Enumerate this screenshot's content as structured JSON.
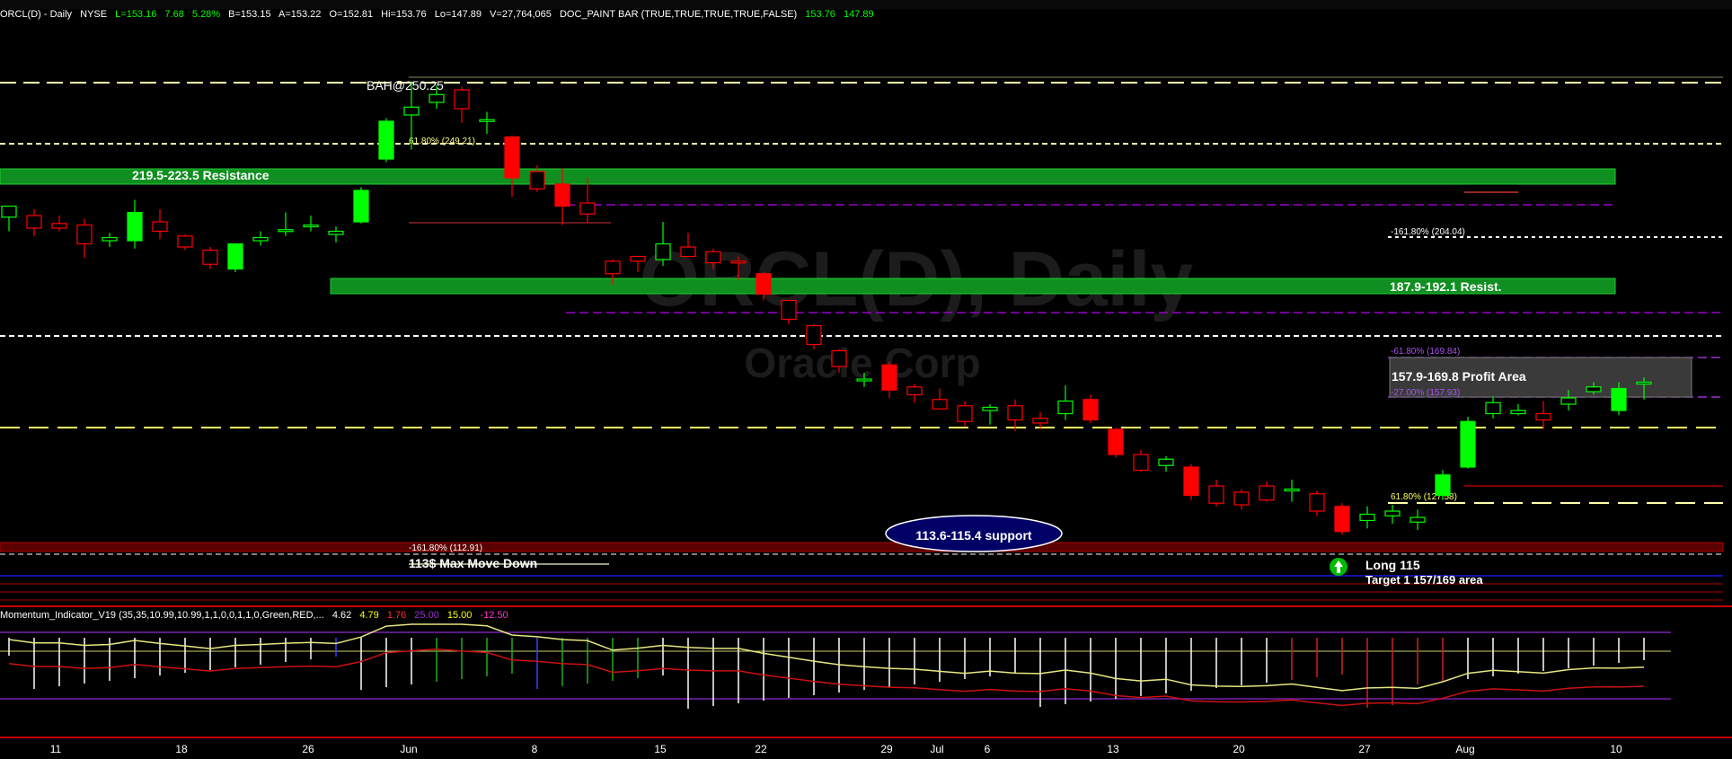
{
  "header": {
    "symbol": "ORCL(D) - Daily",
    "exchange": "NYSE",
    "last": "L=153.16",
    "change": "7.68",
    "change_pct": "5.28%",
    "bid": "B=153.15",
    "ask": "A=153.22",
    "open": "O=152.81",
    "high": "Hi=153.76",
    "low": "Lo=147.89",
    "volume": "V=27,764,065",
    "study": "DOC_PAINT BAR (TRUE,TRUE,TRUE,TRUE,FALSE)",
    "study_v1": "153.76",
    "study_v2": "147.89"
  },
  "watermark": {
    "line1": "ORCL(D), Daily",
    "line2": "Oracle Corp"
  },
  "annotations": {
    "resistance_upper": "219.5-223.5 Resistance",
    "resistance_lower": "187.9-192.1 Resist.",
    "profit_area": "157.9-169.8 Profit Area",
    "support_oval": "113.6-115.4 support",
    "max_move": "113$ Max Move Down",
    "long_entry": "Long 115",
    "target": "Target 1 157/169 area",
    "top_label": "BAH@250.25",
    "fib_top": "61.80% (249.21)",
    "fib_ext_up": "-161.80% (204.04)",
    "fib_profit_hi": "-61.80% (169.84)",
    "fib_profit_lo": "-27.00% (157.93)",
    "fib_61": "61.80% (127.58)",
    "fib_ext_down": "-161.80% (112.91)"
  },
  "oscillator": {
    "name": "Momentum_Indicator_V19 (35,35,10.99,10.99,1,1,0,0,1,1,0,Green,RED,...",
    "v1": "4.62",
    "v2": "4.79",
    "v3": "1.76",
    "v4": "25.00",
    "v5": "15.00",
    "v6": "-12.50"
  },
  "x_axis_labels": [
    "11",
    "18",
    "26",
    "Jun",
    "8",
    "15",
    "22",
    "29",
    "Jul",
    "6",
    "13",
    "20",
    "27",
    "Aug",
    "10"
  ],
  "colors": {
    "up": "#00ff00",
    "down": "#ff0000",
    "resistance_band": "#0f8f1f",
    "support_band": "#7a0000",
    "fib": "#ffff66",
    "purple": "#9900cc",
    "background": "#000000"
  },
  "chart_data": {
    "type": "candlestick",
    "symbol": "ORCL",
    "timeframe": "Daily",
    "ylim": [
      88,
      268
    ],
    "candles": [
      {
        "o": 207.5,
        "h": 209.5,
        "l": 203.0,
        "c": 211.0
      },
      {
        "o": 208.0,
        "h": 210.0,
        "l": 201.5,
        "c": 204.0
      },
      {
        "o": 205.5,
        "h": 208.0,
        "l": 203.0,
        "c": 204.0
      },
      {
        "o": 205.0,
        "h": 207.0,
        "l": 194.5,
        "c": 199.0
      },
      {
        "o": 200.0,
        "h": 202.5,
        "l": 198.0,
        "c": 201.0
      },
      {
        "o": 200.0,
        "h": 213.0,
        "l": 197.5,
        "c": 209.0
      },
      {
        "o": 206.0,
        "h": 210.0,
        "l": 200.5,
        "c": 203.0
      },
      {
        "o": 201.5,
        "h": 202.0,
        "l": 197.0,
        "c": 198.0
      },
      {
        "o": 197.0,
        "h": 198.0,
        "l": 191.0,
        "c": 192.5
      },
      {
        "o": 191.0,
        "h": 199.0,
        "l": 190.0,
        "c": 199.0
      },
      {
        "o": 200.0,
        "h": 203.0,
        "l": 198.5,
        "c": 201.0
      },
      {
        "o": 203.0,
        "h": 209.0,
        "l": 201.5,
        "c": 203.5
      },
      {
        "o": 205.0,
        "h": 208.0,
        "l": 203.0,
        "c": 205.0
      },
      {
        "o": 202.0,
        "h": 204.5,
        "l": 199.5,
        "c": 203.0
      },
      {
        "o": 206.0,
        "h": 217.0,
        "l": 205.5,
        "c": 216.0
      },
      {
        "o": 226.0,
        "h": 239.0,
        "l": 225.0,
        "c": 238.0
      },
      {
        "o": 240.0,
        "h": 250.5,
        "l": 229.0,
        "c": 242.5
      },
      {
        "o": 244.0,
        "h": 249.5,
        "l": 242.0,
        "c": 246.5
      },
      {
        "o": 248.0,
        "h": 249.0,
        "l": 237.5,
        "c": 242.0
      },
      {
        "o": 238.0,
        "h": 241.0,
        "l": 234.0,
        "c": 238.5
      },
      {
        "o": 233.0,
        "h": 233.5,
        "l": 214.0,
        "c": 220.0
      },
      {
        "o": 222.0,
        "h": 224.0,
        "l": 215.5,
        "c": 216.5
      },
      {
        "o": 218.0,
        "h": 223.0,
        "l": 205.0,
        "c": 211.0
      },
      {
        "o": 212.0,
        "h": 220.0,
        "l": 205.5,
        "c": 208.5
      },
      {
        "o": 193.5,
        "h": 194.0,
        "l": 186.0,
        "c": 189.5
      },
      {
        "o": 195.0,
        "h": 195.0,
        "l": 190.0,
        "c": 193.5
      },
      {
        "o": 194.0,
        "h": 206.0,
        "l": 192.0,
        "c": 199.0
      },
      {
        "o": 198.0,
        "h": 202.5,
        "l": 195.5,
        "c": 195.0
      },
      {
        "o": 196.5,
        "h": 197.5,
        "l": 191.0,
        "c": 193.0
      },
      {
        "o": 193.5,
        "h": 195.0,
        "l": 187.5,
        "c": 193.0
      },
      {
        "o": 189.5,
        "h": 190.0,
        "l": 181.0,
        "c": 183.0
      },
      {
        "o": 181.0,
        "h": 181.0,
        "l": 173.5,
        "c": 175.0
      },
      {
        "o": 173.0,
        "h": 173.5,
        "l": 165.5,
        "c": 167.0
      },
      {
        "o": 165.0,
        "h": 165.5,
        "l": 158.0,
        "c": 160.0
      },
      {
        "o": 156.0,
        "h": 158.0,
        "l": 153.5,
        "c": 156.0
      },
      {
        "o": 160.5,
        "h": 161.5,
        "l": 150.0,
        "c": 152.5
      },
      {
        "o": 153.5,
        "h": 154.5,
        "l": 148.5,
        "c": 151.0
      },
      {
        "o": 149.5,
        "h": 153.0,
        "l": 147.0,
        "c": 146.5
      },
      {
        "o": 147.5,
        "h": 149.0,
        "l": 141.0,
        "c": 142.5
      },
      {
        "o": 146.0,
        "h": 148.0,
        "l": 141.5,
        "c": 147.0
      },
      {
        "o": 147.5,
        "h": 149.5,
        "l": 139.5,
        "c": 143.0
      },
      {
        "o": 143.5,
        "h": 145.5,
        "l": 140.0,
        "c": 142.0
      },
      {
        "o": 145.0,
        "h": 154.0,
        "l": 143.0,
        "c": 149.0
      },
      {
        "o": 149.5,
        "h": 151.0,
        "l": 142.0,
        "c": 143.0
      },
      {
        "o": 140.0,
        "h": 140.5,
        "l": 131.0,
        "c": 132.0
      },
      {
        "o": 132.0,
        "h": 133.5,
        "l": 126.5,
        "c": 127.0
      },
      {
        "o": 128.5,
        "h": 131.5,
        "l": 126.5,
        "c": 130.5
      },
      {
        "o": 128.0,
        "h": 129.0,
        "l": 117.5,
        "c": 119.0
      },
      {
        "o": 122.0,
        "h": 124.0,
        "l": 115.5,
        "c": 116.5
      },
      {
        "o": 120.0,
        "h": 121.0,
        "l": 114.5,
        "c": 116.0
      },
      {
        "o": 122.0,
        "h": 123.5,
        "l": 117.0,
        "c": 117.5
      },
      {
        "o": 121.0,
        "h": 124.0,
        "l": 117.0,
        "c": 121.0
      },
      {
        "o": 119.5,
        "h": 120.5,
        "l": 112.5,
        "c": 114.0
      },
      {
        "o": 115.5,
        "h": 116.5,
        "l": 106.5,
        "c": 107.5
      },
      {
        "o": 111.0,
        "h": 115.5,
        "l": 108.5,
        "c": 113.0
      },
      {
        "o": 112.5,
        "h": 116.0,
        "l": 110.0,
        "c": 114.0
      },
      {
        "o": 110.5,
        "h": 114.5,
        "l": 108.0,
        "c": 112.0
      },
      {
        "o": 119.0,
        "h": 127.0,
        "l": 117.5,
        "c": 125.5
      },
      {
        "o": 128.0,
        "h": 144.0,
        "l": 127.5,
        "c": 142.5
      },
      {
        "o": 145.0,
        "h": 150.5,
        "l": 143.5,
        "c": 148.5
      },
      {
        "o": 145.0,
        "h": 148.0,
        "l": 144.5,
        "c": 146.0
      },
      {
        "o": 145.0,
        "h": 149.0,
        "l": 140.0,
        "c": 143.0
      },
      {
        "o": 148.0,
        "h": 152.5,
        "l": 146.0,
        "c": 150.0
      },
      {
        "o": 152.0,
        "h": 155.0,
        "l": 151.0,
        "c": 153.5
      },
      {
        "o": 146.0,
        "h": 155.0,
        "l": 144.5,
        "c": 153.0
      },
      {
        "o": 155.0,
        "h": 156.5,
        "l": 149.5,
        "c": 155.0
      }
    ],
    "resistance_zones": [
      {
        "label": "219.5-223.5 Resistance",
        "low": 219.5,
        "high": 223.5
      },
      {
        "label": "187.9-192.1 Resist.",
        "low": 187.9,
        "high": 192.1
      }
    ],
    "profit_area": {
      "label": "157.9-169.8 Profit Area",
      "low": 157.9,
      "high": 169.8
    },
    "support_zone": {
      "label": "113.6-115.4 support",
      "low": 113.6,
      "high": 115.4
    },
    "levels": [
      {
        "label": "BAH@250.25",
        "value": 250.25
      },
      {
        "label": "61.80% (249.21)",
        "value": 249.21
      },
      {
        "label": "-161.80% (204.04)",
        "value": 204.04
      },
      {
        "label": "-61.80% (169.84)",
        "value": 169.84
      },
      {
        "label": "-27.00% (157.93)",
        "value": 157.93
      },
      {
        "label": "61.80% (127.58)",
        "value": 127.58
      },
      {
        "label": "-161.80% (112.91)",
        "value": 112.91
      }
    ]
  }
}
